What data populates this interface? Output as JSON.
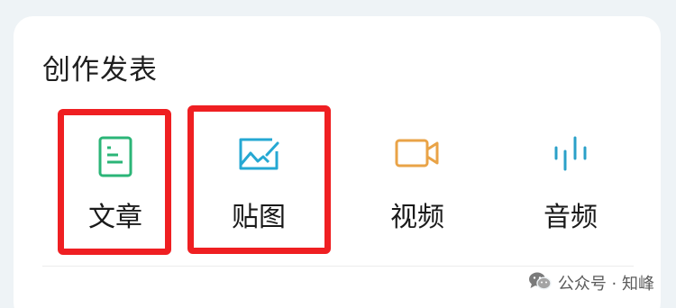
{
  "section": {
    "title": "创作发表"
  },
  "items": [
    {
      "label": "文章",
      "icon": "document-icon",
      "color": "#2bb577",
      "highlighted": true
    },
    {
      "label": "贴图",
      "icon": "image-icon",
      "color": "#25a8d3",
      "highlighted": true
    },
    {
      "label": "视频",
      "icon": "video-camera-icon",
      "color": "#e9a347",
      "highlighted": false
    },
    {
      "label": "音频",
      "icon": "audio-wave-icon",
      "color": "#2aa0c8",
      "highlighted": false
    }
  ],
  "highlight_color": "#ef1f22",
  "watermark": {
    "text": "公众号 · 知峰",
    "icon": "wechat-icon"
  }
}
